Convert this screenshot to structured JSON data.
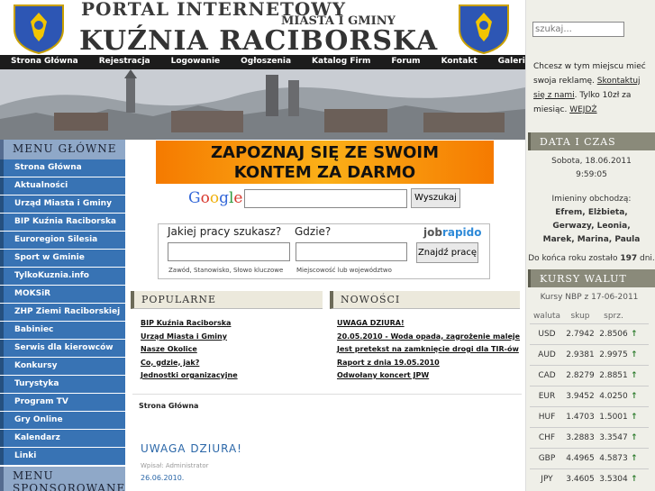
{
  "header": {
    "title_line1": "PORTAL INTERNETOWY",
    "title_line2": "MIASTA I GMINY",
    "title_line3": "KUŹNIA RACIBORSKA"
  },
  "nav": [
    "Strona Główna",
    "Rejestracja",
    "Logowanie",
    "Ogłoszenia",
    "Katalog Firm",
    "Forum",
    "Kontakt",
    "Galeria"
  ],
  "right": {
    "search_placeholder": "szukaj...",
    "ad_text": "Chcesz w tym miejscu mieć swoja reklamę.",
    "ad_link": "Skontaktuj się z nami",
    "ad_price": ". Tylko 10zł za miesiąc.",
    "ad_enter": "WEJDŹ",
    "date_header": "DATA I CZAS",
    "date": "Sobota, 18.06.2011",
    "time": "9:59:05",
    "nameday_label": "Imieniny obchodzą:",
    "names": "Efrem, Elżbieta, Gerwazy, Leonia, Marek, Marina, Paula",
    "year_end_prefix": "Do końca roku zostało",
    "year_end_days": "197",
    "year_end_suffix": "dni.",
    "fx_header": "KURSY WALUT",
    "fx_source": "Kursy NBP z 17-06-2011",
    "fx_cols": [
      "waluta",
      "skup",
      "sprz."
    ],
    "fx": [
      {
        "cur": "USD",
        "buy": "2.7942",
        "sell": "2.8506"
      },
      {
        "cur": "AUD",
        "buy": "2.9381",
        "sell": "2.9975"
      },
      {
        "cur": "CAD",
        "buy": "2.8279",
        "sell": "2.8851"
      },
      {
        "cur": "EUR",
        "buy": "3.9452",
        "sell": "4.0250"
      },
      {
        "cur": "HUF",
        "buy": "1.4703",
        "sell": "1.5001"
      },
      {
        "cur": "CHF",
        "buy": "3.2883",
        "sell": "3.3547"
      },
      {
        "cur": "GBP",
        "buy": "4.4965",
        "sell": "4.5873"
      },
      {
        "cur": "JPY",
        "buy": "3.4605",
        "sell": "3.5304"
      }
    ]
  },
  "left": {
    "menu_header": "MENU GŁÓWNE",
    "items": [
      "Strona Główna",
      "Aktualności",
      "Urząd Miasta i Gminy",
      "BIP Kuźnia Raciborska",
      "Euroregion Silesia",
      "Sport w Gminie",
      "TylkoKuznia.info",
      "MOKSiR",
      "ZHP Ziemi Raciborskiej",
      "Babiniec",
      "Serwis dla kierowców",
      "Konkursy",
      "Turystyka",
      "Program TV",
      "Gry Online",
      "Kalendarz",
      "Linki"
    ],
    "menu2_header": "MENU",
    "menu3_header": "SPONSOROWANE"
  },
  "center": {
    "banner_line1": "ZAPOZNAJ SIĘ ZE SWOIM",
    "banner_line2": "KONTEM ZA DARMO",
    "google": "Google",
    "google_btn": "Wyszukaj",
    "job_q1": "Jakiej pracy szukasz?",
    "job_q2": "Gdzie?",
    "job_logo_a": "job",
    "job_logo_b": "rapido",
    "job_btn": "Znajdź pracę",
    "job_hint1": "Zawód, Stanowisko, Słowo kluczowe",
    "job_hint2": "Miejscowość lub województwo",
    "popular_header": "POPULARNE",
    "popular": [
      "BIP Kuźnia Raciborska",
      "Urząd Miasta i Gminy",
      "Nasze Okolice",
      "Co, gdzie, jak?",
      "Jednostki organizacyjne"
    ],
    "news_header": "NOWOŚCI",
    "news": [
      "UWAGA DZIURA!",
      "20.05.2010 - Woda opada, zagrożenie maleje",
      "Jest pretekst na zamknięcie drogi dla TIR-ów",
      "Raport z dnia 19.05.2010",
      "Odwołany koncert JPW"
    ],
    "breadcrumb": "Strona Główna",
    "article_title": "UWAGA DZIURA!",
    "article_author": "Wpisał: Administrator",
    "article_date": "26.06.2010."
  }
}
